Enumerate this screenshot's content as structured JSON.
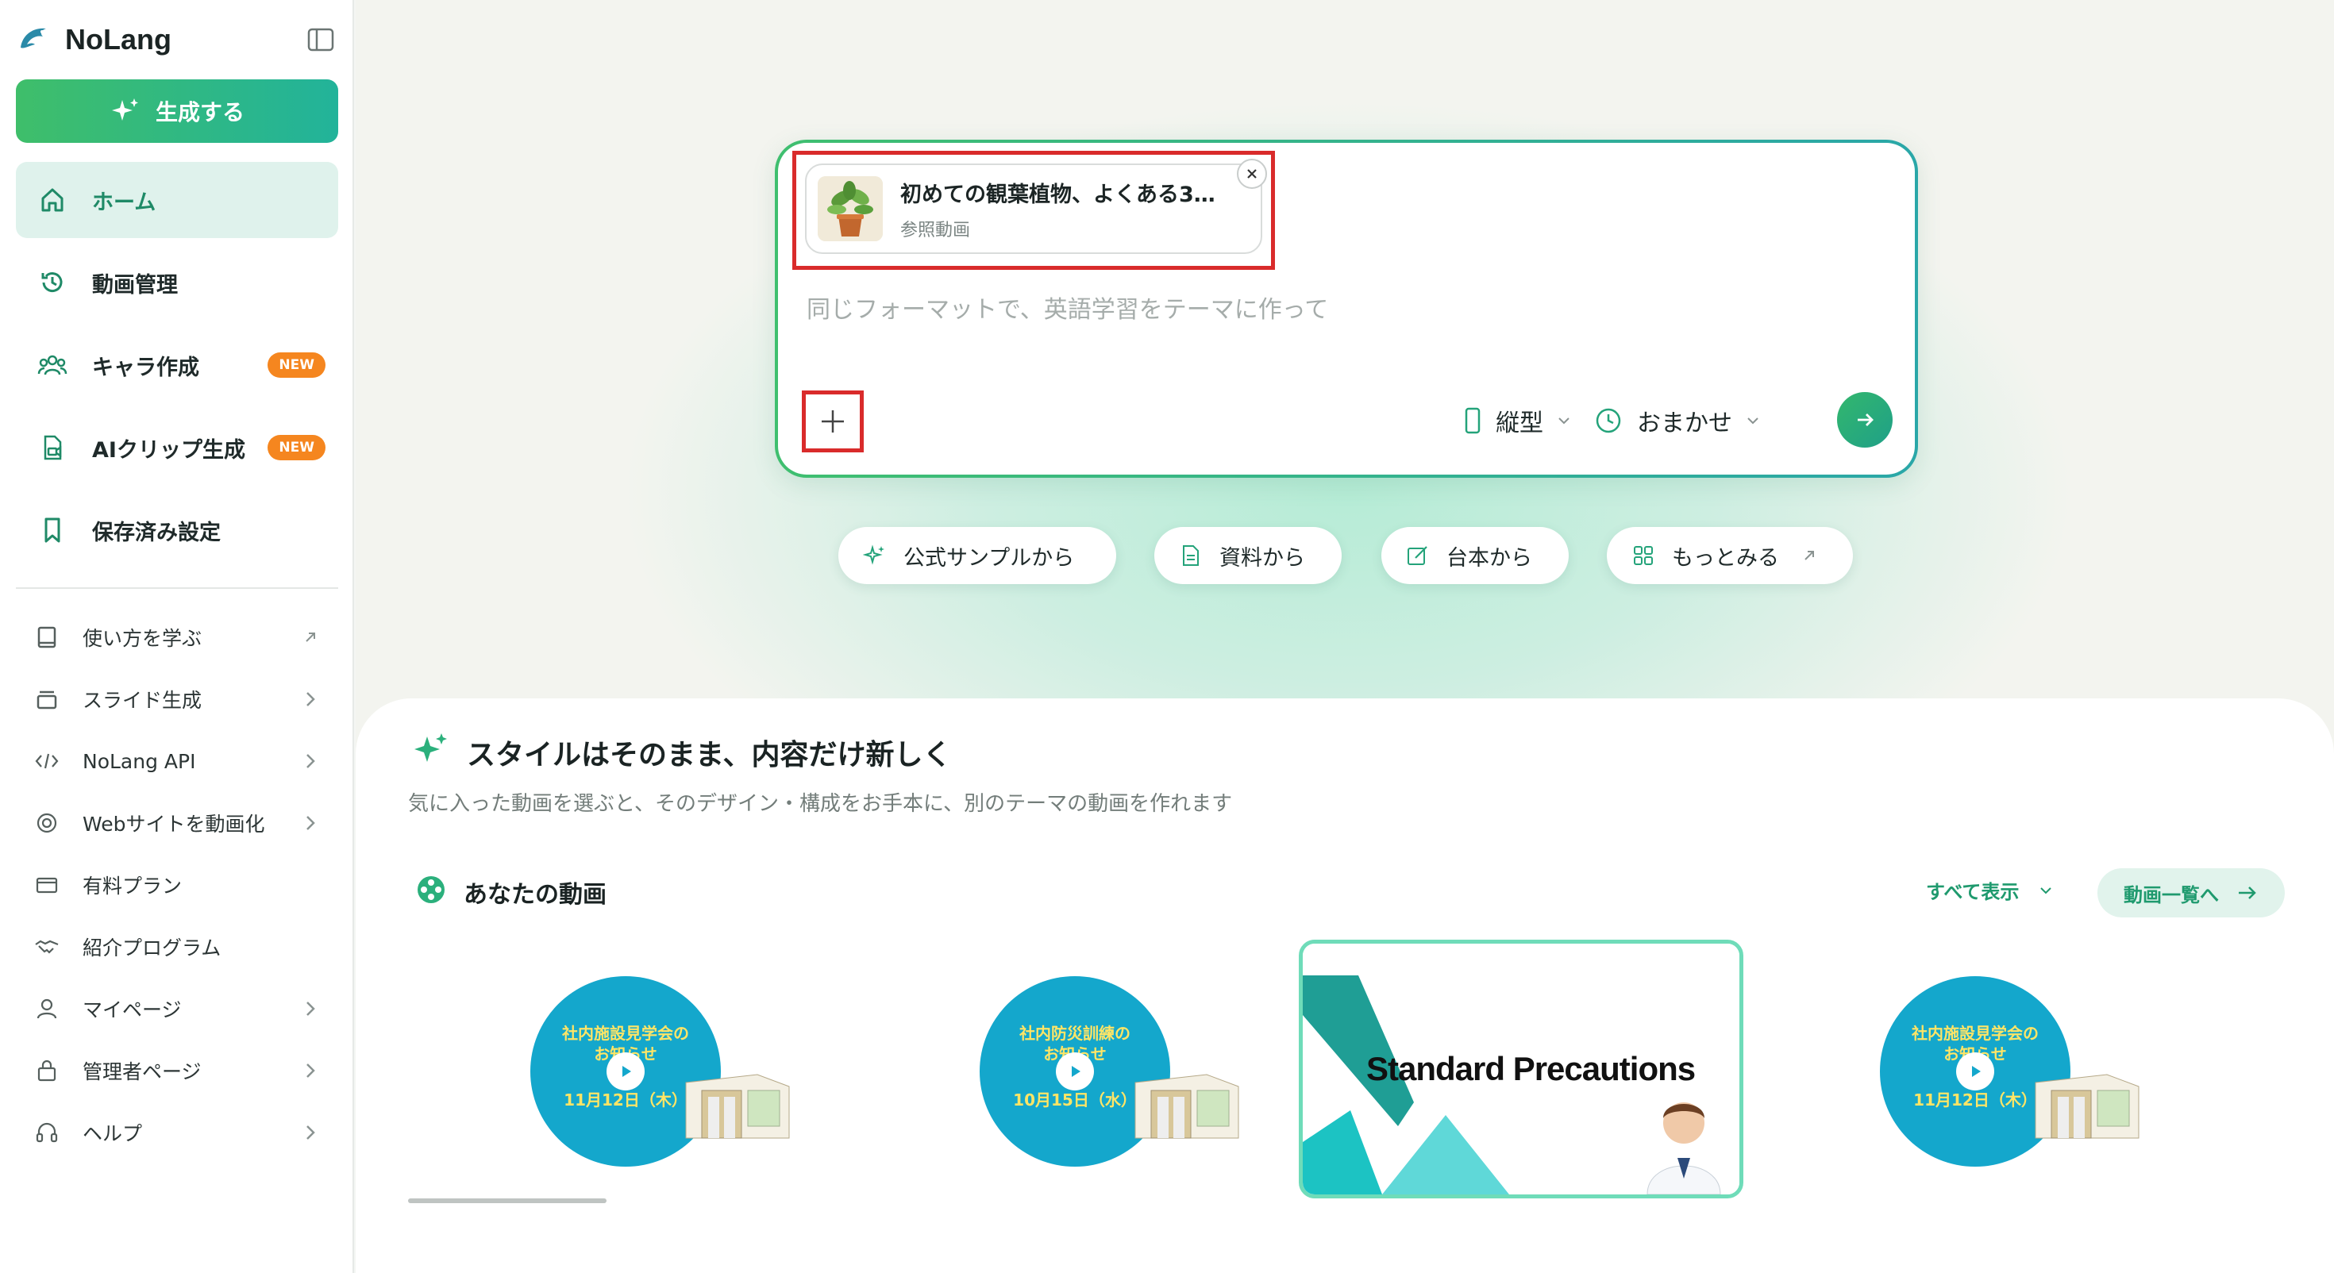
{
  "app": {
    "name": "NoLang"
  },
  "sidebar": {
    "generate_label": "生成する",
    "nav": [
      {
        "label": "ホーム",
        "icon": "home-icon",
        "active": true
      },
      {
        "label": "動画管理",
        "icon": "history-icon"
      },
      {
        "label": "キャラ作成",
        "icon": "users-icon",
        "badge": "NEW"
      },
      {
        "label": "AIクリップ生成",
        "icon": "clip-icon",
        "badge": "NEW"
      },
      {
        "label": "保存済み設定",
        "icon": "bookmark-icon"
      }
    ],
    "subnav": [
      {
        "label": "使い方を学ぶ",
        "icon": "book-icon",
        "trail": "external"
      },
      {
        "label": "スライド生成",
        "icon": "slides-icon",
        "trail": "chevron"
      },
      {
        "label": "NoLang API",
        "icon": "code-icon",
        "trail": "chevron"
      },
      {
        "label": "Webサイトを動画化",
        "icon": "globe-icon",
        "trail": "chevron"
      },
      {
        "label": "有料プラン",
        "icon": "card-icon",
        "trail": "none"
      },
      {
        "label": "紹介プログラム",
        "icon": "handshake-icon",
        "trail": "none"
      },
      {
        "label": "マイページ",
        "icon": "user-icon",
        "trail": "chevron"
      },
      {
        "label": "管理者ページ",
        "icon": "admin-icon",
        "trail": "chevron"
      },
      {
        "label": "ヘルプ",
        "icon": "headset-icon",
        "trail": "chevron"
      }
    ]
  },
  "prompt": {
    "reference": {
      "title": "初めての観葉植物、よくある3…",
      "subtitle": "参照動画"
    },
    "placeholder": "同じフォーマットで、英語学習をテーマに作って",
    "orientation": "縦型",
    "duration": "おまかせ"
  },
  "quick_actions": [
    {
      "label": "公式サンプルから",
      "icon": "sparkle-icon"
    },
    {
      "label": "資料から",
      "icon": "document-icon"
    },
    {
      "label": "台本から",
      "icon": "edit-icon"
    },
    {
      "label": "もっとみる",
      "icon": "grid-icon"
    }
  ],
  "panel": {
    "title": "スタイルはそのまま、内容だけ新しく",
    "description": "気に入った動画を選ぶと、そのデザイン・構成をお手本に、別のテーマの動画を作れます",
    "section_title": "あなたの動画",
    "show_all": "すべて表示",
    "list_button": "動画一覧へ"
  },
  "videos": [
    {
      "lines": [
        "社内施設見学会の",
        "お知らせ",
        "11月12日（木）"
      ]
    },
    {
      "lines": [
        "社内防災訓練の",
        "お知らせ",
        "10月15日（水）"
      ]
    },
    {
      "title": "Standard Precautions"
    },
    {
      "lines": [
        "社内施設見学会の",
        "お知らせ",
        "11月12日（木）"
      ]
    }
  ],
  "colors": {
    "brand": "#22b39a",
    "highlight": "#d92b2b",
    "badge": "#f5861f"
  }
}
